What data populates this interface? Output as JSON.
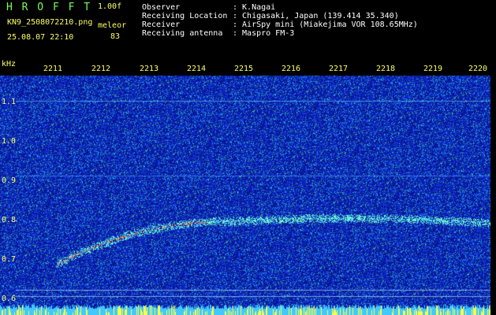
{
  "app": {
    "name_letters": "H R O F F T",
    "version": "1.00f",
    "filename": "KN9_2508072210.png",
    "datetime": "25.08.07 22:10",
    "mode_label": "meleor",
    "count": "83"
  },
  "info": {
    "labels": [
      "Observer",
      "Receiving Location",
      "Receiver",
      "Receiving antenna"
    ],
    "values": [
      ": K.Nagai",
      ": Chigasaki, Japan (139.414 35.340)",
      ": AirSpy mini (Miakejima VOR 108.65MHz)",
      ": Maspro FM-3"
    ]
  },
  "axis": {
    "y_unit": "kHz",
    "y_ticks": [
      "1.1",
      "1.0",
      "0.9",
      "0.8",
      "0.7",
      "0.6"
    ],
    "x_ticks": [
      "2211",
      "2212",
      "2213",
      "2214",
      "2215",
      "2216",
      "2217",
      "2218",
      "2219",
      "2220"
    ]
  },
  "colors": {
    "background": "#000000",
    "spectrogram_base": "#0a1aa8",
    "label_yellow": "#FFFF66",
    "title_green": "#7CFC5A"
  }
}
